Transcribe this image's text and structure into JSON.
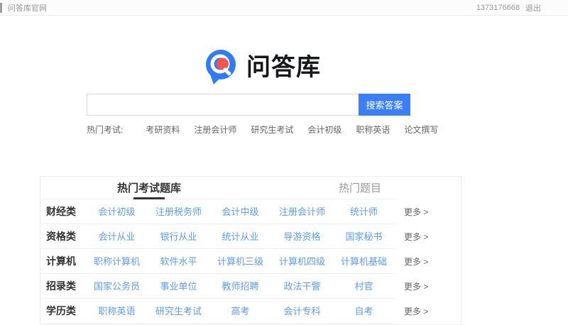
{
  "topbar": {
    "site_link": "问答库官网",
    "user_id": "1373176668",
    "logout": "退出"
  },
  "logo": {
    "title": "问答库"
  },
  "search": {
    "button_label": "搜索答案",
    "value": ""
  },
  "hot_exams": {
    "label": "热门考试:",
    "links": [
      "考研资料",
      "注册会计师",
      "研究生考试",
      "会计初级",
      "职称英语",
      "论文撰写"
    ]
  },
  "panel": {
    "tabs": [
      {
        "label": "热门考试题库",
        "active": true
      },
      {
        "label": "热门题目",
        "active": false
      }
    ],
    "more_label": "更多 >",
    "rows": [
      {
        "category": "财经类",
        "links": [
          "会计初级",
          "注册税务师",
          "会计中级",
          "注册会计师",
          "统计师"
        ]
      },
      {
        "category": "资格类",
        "links": [
          "会计从业",
          "银行从业",
          "统计从业",
          "导游资格",
          "国家秘书"
        ]
      },
      {
        "category": "计算机",
        "links": [
          "职称计算机",
          "软件水平",
          "计算机三级",
          "计算机四级",
          "计算机基础"
        ]
      },
      {
        "category": "招录类",
        "links": [
          "国家公务员",
          "事业单位",
          "教师招聘",
          "政法干警",
          "村官"
        ]
      },
      {
        "category": "学历类",
        "links": [
          "职称英语",
          "研究生考试",
          "高考",
          "会计专科",
          "自考"
        ]
      }
    ]
  },
  "colors": {
    "accent_blue": "#3a7ef8",
    "link_blue": "#5e9cf2",
    "logo_blue": "#2f7cf6",
    "logo_red": "#f5564c",
    "text_dark": "#333333",
    "text_gray": "#999999"
  }
}
